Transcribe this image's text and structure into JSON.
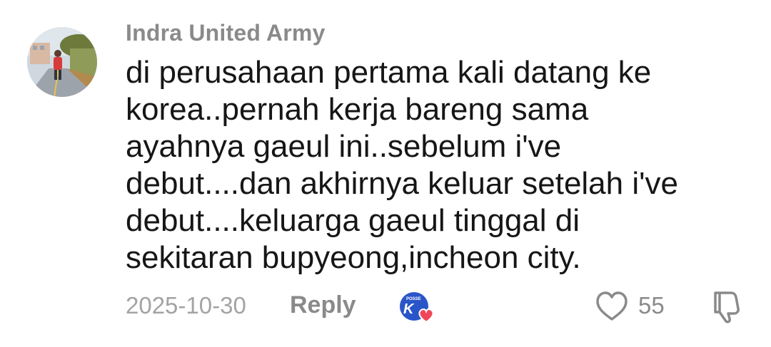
{
  "comment": {
    "username": "Indra United Army",
    "lines": [
      "di perusahaan pertama kali datang ke",
      "korea..pernah kerja bareng sama",
      "ayahnya gaeul ini..sebelum i've",
      "debut....dan akhirnya keluar setelah i've",
      "debut....keluarga gaeul tinggal di",
      "sekitaran bupyeong,incheon city."
    ],
    "date": "2025-10-30",
    "reply_label": "Reply",
    "like_count": "55",
    "avatar_icon": "user-avatar-photo",
    "creator_badge_icon": "creator-liked-badge",
    "like_icon": "heart-outline-icon",
    "dislike_icon": "thumbs-down-outline-icon"
  },
  "colors": {
    "username": "#8a8a8a",
    "text": "#161616",
    "meta": "#a3a3a3",
    "badge_blue": "#2a55c9",
    "badge_heart": "#f0465a"
  }
}
